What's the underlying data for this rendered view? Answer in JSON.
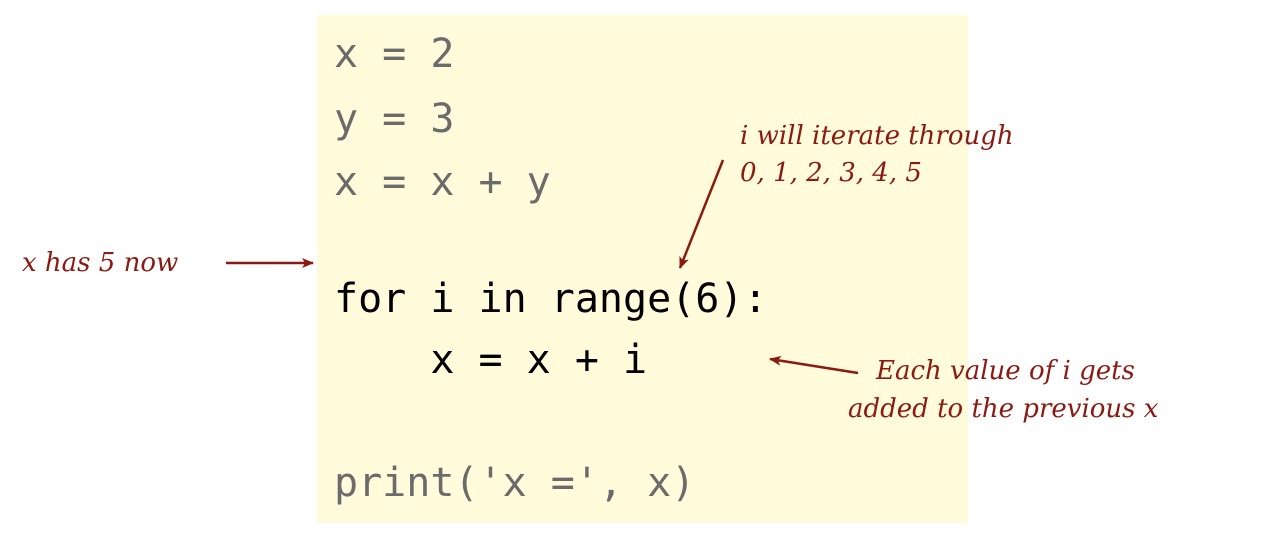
{
  "code": {
    "lines": [
      "x = 2",
      "y = 3",
      "x = x + y",
      "for i in range(6):",
      "    x = x + i",
      "print('x =', x)"
    ]
  },
  "annotations": {
    "x_value": "x has 5 now",
    "iterate_line1": "i will iterate through",
    "iterate_line2": "0, 1, 2, 3, 4, 5",
    "added_line1": "Each value of i gets",
    "added_line2": "added to the previous x"
  },
  "colors": {
    "panel": "#fffbdb",
    "annotation": "#8a1a12",
    "code_dim": "#6b6b6b",
    "code_active": "#000000"
  }
}
